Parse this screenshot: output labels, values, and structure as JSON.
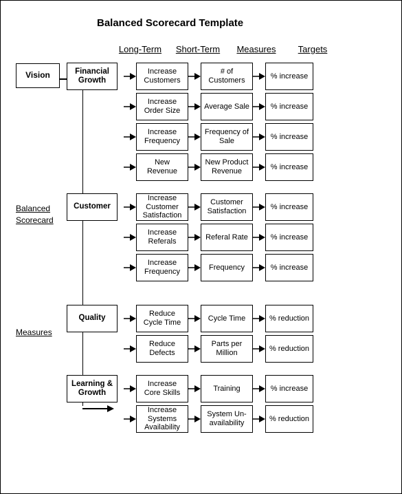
{
  "title": "Balanced Scorecard Template",
  "vision": "Vision",
  "side_labels": {
    "balanced": "Balanced",
    "scorecard": "Scorecard",
    "measures": "Measures"
  },
  "col_headers": [
    "Long-Term",
    "Short-Term",
    "Measures",
    "Targets"
  ],
  "sections": [
    {
      "long_term": "Financial Growth",
      "rows": [
        {
          "short": "Increase Customers",
          "measure": "# of Customers",
          "target": "% increase"
        },
        {
          "short": "Increase Order Size",
          "measure": "Average Sale",
          "target": "% increase"
        },
        {
          "short": "Increase Frequency",
          "measure": "Frequency of Sale",
          "target": "% increase"
        },
        {
          "short": "New Revenue",
          "measure": "New Product Revenue",
          "target": "% increase"
        }
      ]
    },
    {
      "long_term": "Customer",
      "rows": [
        {
          "short": "Increase Customer Satisfaction",
          "measure": "Customer Satisfaction",
          "target": "% increase"
        },
        {
          "short": "Increase Referals",
          "measure": "Referal Rate",
          "target": "% increase"
        },
        {
          "short": "Increase Frequency",
          "measure": "Frequency",
          "target": "% increase"
        }
      ]
    },
    {
      "long_term": "Quality",
      "rows": [
        {
          "short": "Reduce Cycle Time",
          "measure": "Cycle Time",
          "target": "% reduction"
        },
        {
          "short": "Reduce Defects",
          "measure": "Parts per Million",
          "target": "% reduction"
        }
      ]
    },
    {
      "long_term": "Learning & Growth",
      "rows": [
        {
          "short": "Increase Core Skills",
          "measure": "Training",
          "target": "% increase"
        },
        {
          "short": "Increase Systems Availability",
          "measure": "System Un-availability",
          "target": "% reduction"
        }
      ]
    }
  ]
}
